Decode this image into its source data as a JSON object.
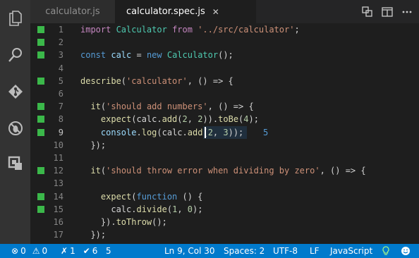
{
  "tabs": [
    {
      "label": "calculator.js",
      "active": false
    },
    {
      "label": "calculator.spec.js",
      "active": true,
      "close_glyph": "✕"
    }
  ],
  "title_actions": [
    "compare-icon",
    "split-editor-icon",
    "more-actions-icon"
  ],
  "activity_bar": [
    "explorer-icon",
    "search-icon",
    "source-control-icon",
    "debug-icon",
    "extensions-icon"
  ],
  "editor": {
    "lines": [
      {
        "num": "1",
        "mark": true,
        "tokens": [
          {
            "t": "import ",
            "c": "k"
          },
          {
            "t": "Calculator ",
            "c": "c"
          },
          {
            "t": "from ",
            "c": "k"
          },
          {
            "t": "'../src/calculator'",
            "c": "s"
          },
          {
            "t": ";",
            "c": ""
          }
        ]
      },
      {
        "num": "2",
        "mark": true,
        "tokens": []
      },
      {
        "num": "3",
        "mark": true,
        "tokens": [
          {
            "t": "const ",
            "c": "b"
          },
          {
            "t": "calc",
            "c": "v"
          },
          {
            "t": " = ",
            "c": ""
          },
          {
            "t": "new ",
            "c": "b"
          },
          {
            "t": "Calculator",
            "c": "c"
          },
          {
            "t": "();",
            "c": ""
          }
        ]
      },
      {
        "num": "4",
        "mark": false,
        "tokens": []
      },
      {
        "num": "5",
        "mark": true,
        "tokens": [
          {
            "t": "describe",
            "c": "y"
          },
          {
            "t": "(",
            "c": ""
          },
          {
            "t": "'calculator'",
            "c": "s"
          },
          {
            "t": ", () => {",
            "c": ""
          }
        ]
      },
      {
        "num": "6",
        "mark": false,
        "tokens": []
      },
      {
        "num": "7",
        "mark": true,
        "tokens": [
          {
            "t": "  it",
            "c": "y"
          },
          {
            "t": "(",
            "c": ""
          },
          {
            "t": "'should add numbers'",
            "c": "s"
          },
          {
            "t": ", () => {",
            "c": ""
          }
        ]
      },
      {
        "num": "8",
        "mark": true,
        "tokens": [
          {
            "t": "    expect",
            "c": "y"
          },
          {
            "t": "(calc.",
            "c": ""
          },
          {
            "t": "add",
            "c": "y"
          },
          {
            "t": "(",
            "c": ""
          },
          {
            "t": "2",
            "c": "n"
          },
          {
            "t": ", ",
            "c": ""
          },
          {
            "t": "2",
            "c": "n"
          },
          {
            "t": ")).",
            "c": ""
          },
          {
            "t": "toBe",
            "c": "y"
          },
          {
            "t": "(",
            "c": ""
          },
          {
            "t": "4",
            "c": "n"
          },
          {
            "t": ");",
            "c": ""
          }
        ]
      },
      {
        "num": "9",
        "mark": true,
        "current": true,
        "tokens": [
          {
            "t": "    console",
            "c": "v"
          },
          {
            "t": ".",
            "c": ""
          },
          {
            "t": "log",
            "c": "y"
          },
          {
            "t": "(calc.",
            "c": ""
          },
          {
            "t": "add",
            "c": "y"
          },
          {
            "t": "(",
            "c": ""
          },
          {
            "t": "2",
            "c": "n"
          },
          {
            "t": ", ",
            "c": ""
          },
          {
            "t": "3",
            "c": "n"
          },
          {
            "t": "));",
            "c": ""
          }
        ],
        "inline_result": "5"
      },
      {
        "num": "10",
        "mark": false,
        "tokens": [
          {
            "t": "  });",
            "c": ""
          }
        ]
      },
      {
        "num": "11",
        "mark": false,
        "tokens": []
      },
      {
        "num": "12",
        "mark": true,
        "tokens": [
          {
            "t": "  it",
            "c": "y"
          },
          {
            "t": "(",
            "c": ""
          },
          {
            "t": "'should throw error when dividing by zero'",
            "c": "s"
          },
          {
            "t": ", () => {",
            "c": ""
          }
        ]
      },
      {
        "num": "13",
        "mark": false,
        "tokens": []
      },
      {
        "num": "14",
        "mark": true,
        "tokens": [
          {
            "t": "    expect",
            "c": "y"
          },
          {
            "t": "(",
            "c": ""
          },
          {
            "t": "function",
            "c": "b"
          },
          {
            "t": " () {",
            "c": ""
          }
        ]
      },
      {
        "num": "15",
        "mark": true,
        "tokens": [
          {
            "t": "      calc.",
            "c": ""
          },
          {
            "t": "divide",
            "c": "y"
          },
          {
            "t": "(",
            "c": ""
          },
          {
            "t": "1",
            "c": "n"
          },
          {
            "t": ", ",
            "c": ""
          },
          {
            "t": "0",
            "c": "n"
          },
          {
            "t": ");",
            "c": ""
          }
        ]
      },
      {
        "num": "16",
        "mark": false,
        "tokens": [
          {
            "t": "    }).",
            "c": ""
          },
          {
            "t": "toThrow",
            "c": "y"
          },
          {
            "t": "();",
            "c": ""
          }
        ]
      },
      {
        "num": "17",
        "mark": false,
        "tokens": [
          {
            "t": "  });",
            "c": ""
          }
        ]
      }
    ]
  },
  "status": {
    "errors": "0",
    "warnings": "0",
    "fails": "1",
    "passes": "6",
    "count": "5",
    "position": "Ln 9, Col 30",
    "spaces": "Spaces: 2",
    "encoding": "UTF-8",
    "eol": "LF",
    "language": "JavaScript"
  }
}
